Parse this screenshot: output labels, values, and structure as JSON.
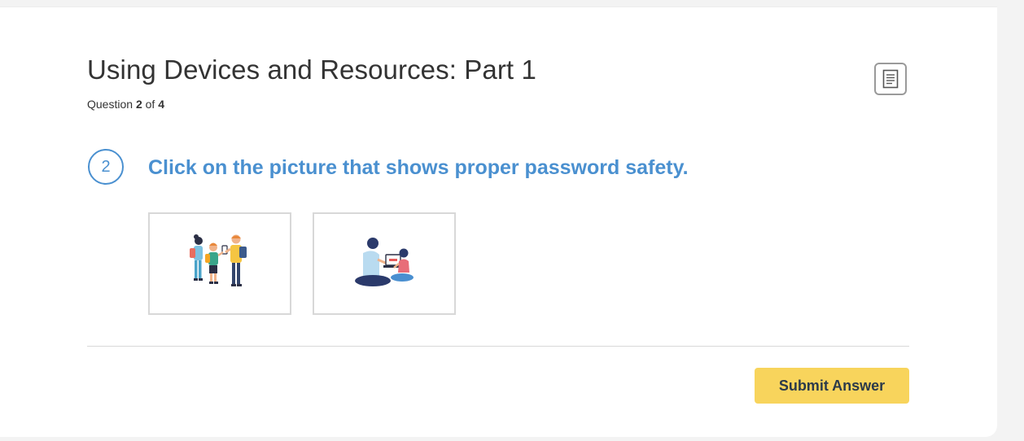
{
  "quiz": {
    "title": "Using Devices and Resources: Part 1",
    "progress_prefix": "Question",
    "current": "2",
    "of_word": "of",
    "total": "4"
  },
  "toolbar": {
    "notes_icon": "document-icon"
  },
  "question": {
    "number": "2",
    "prompt": "Click on the picture that shows proper password safety.",
    "choices": [
      {
        "illustration": "children-sharing-phone-illustration"
      },
      {
        "illustration": "adult-helping-child-at-laptop-illustration"
      }
    ]
  },
  "actions": {
    "submit_label": "Submit Answer"
  },
  "colors": {
    "accent_blue": "#4a90d0",
    "submit_yellow": "#f8d45c",
    "title_text": "#333333"
  }
}
